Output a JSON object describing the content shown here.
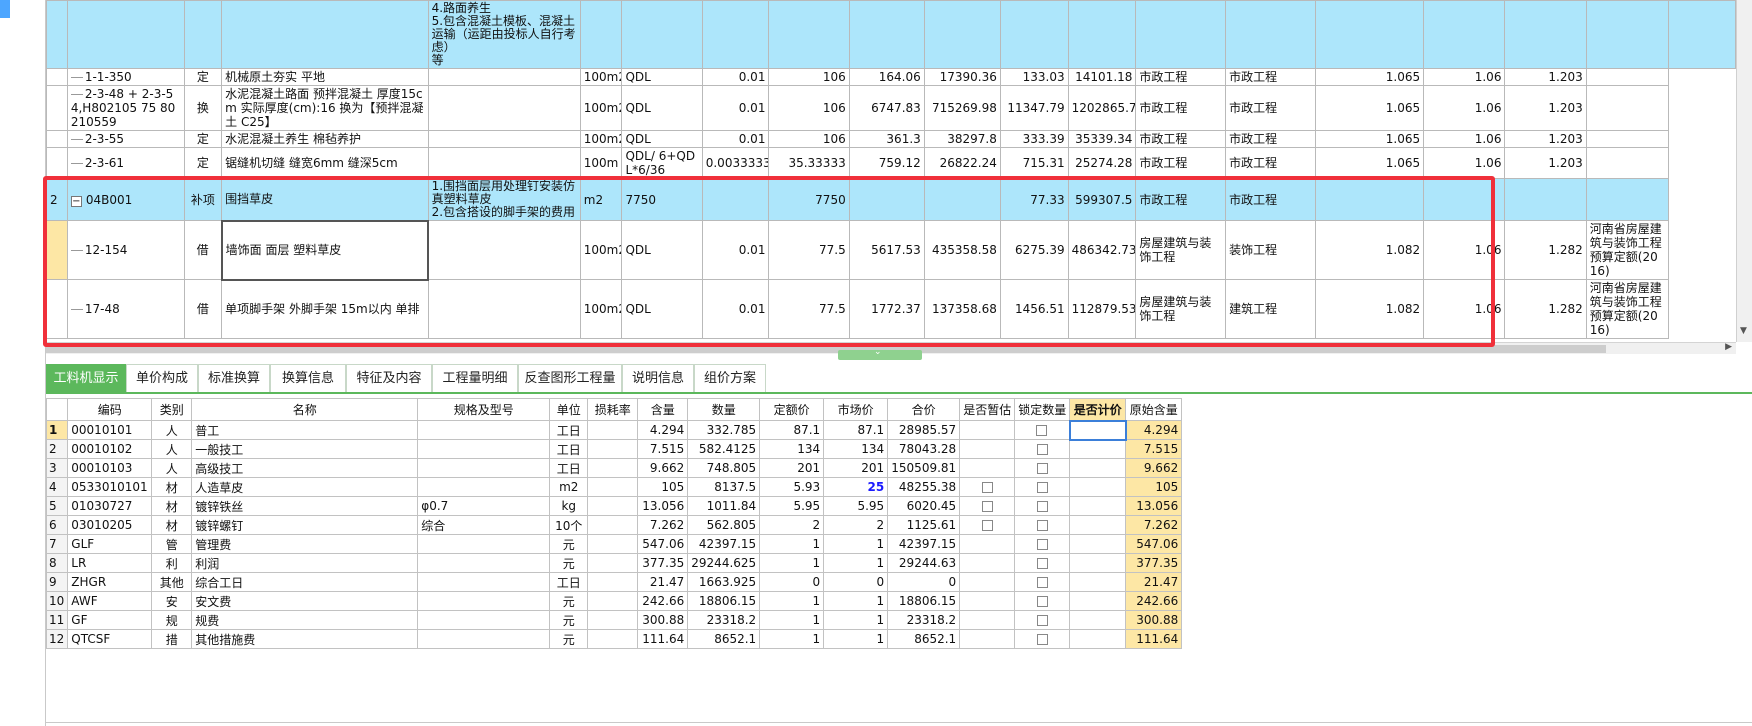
{
  "upper": {
    "top_row": {
      "description": "4.路面养生\n5.包含混凝土模板、混凝土运输（运距由投标人自行考虑）\n等"
    },
    "rows": [
      {
        "num": "",
        "code": "1-1-350",
        "type": "定",
        "name": "机械原土夯实 平地",
        "desc": "",
        "unit": "100m2",
        "qty_expr": "QDL",
        "qty": "0.01",
        "count": "106",
        "unit_price": "164.06",
        "total": "17390.36",
        "c1": "133.03",
        "c2": "14101.18",
        "major1": "市政工程",
        "major2": "市政工程",
        "f1": "1.065",
        "f2": "1.06",
        "f3": "1.203",
        "remark": ""
      },
      {
        "num": "",
        "code": "2-3-48 + 2-3-54,H802105 75 80210559",
        "type": "换",
        "name": "水泥混凝土路面 预拌混凝土 厚度15cm 实际厚度(cm):16 换为【预拌混凝土 C25】",
        "desc": "",
        "unit": "100m2",
        "qty_expr": "QDL",
        "qty": "0.01",
        "count": "106",
        "unit_price": "6747.83",
        "total": "715269.98",
        "c1": "11347.79",
        "c2": "1202865.74",
        "major1": "市政工程",
        "major2": "市政工程",
        "f1": "1.065",
        "f2": "1.06",
        "f3": "1.203",
        "remark": ""
      },
      {
        "num": "",
        "code": "2-3-55",
        "type": "定",
        "name": "水泥混凝土养生 棉毡养护",
        "desc": "",
        "unit": "100m2",
        "qty_expr": "QDL",
        "qty": "0.01",
        "count": "106",
        "unit_price": "361.3",
        "total": "38297.8",
        "c1": "333.39",
        "c2": "35339.34",
        "major1": "市政工程",
        "major2": "市政工程",
        "f1": "1.065",
        "f2": "1.06",
        "f3": "1.203",
        "remark": ""
      },
      {
        "num": "",
        "code": "2-3-61",
        "type": "定",
        "name": "锯缝机切缝 缝宽6mm 缝深5cm",
        "desc": "",
        "unit": "100m",
        "qty_expr": "QDL/ 6+QDL*6/36",
        "qty": "0.0033333",
        "count": "35.33333",
        "unit_price": "759.12",
        "total": "26822.24",
        "c1": "715.31",
        "c2": "25274.28",
        "major1": "市政工程",
        "major2": "市政工程",
        "f1": "1.065",
        "f2": "1.06",
        "f3": "1.203",
        "remark": ""
      },
      {
        "num": "2",
        "code": "04B001",
        "type": "补项",
        "name": "围挡草皮",
        "desc": "1.围挡面层用处理钉安装仿真塑料草皮\n2.包含搭设的脚手架的费用",
        "unit": "m2",
        "qty_expr": "7750",
        "qty": "",
        "count": "7750",
        "unit_price": "",
        "total": "",
        "c1": "77.33",
        "c2": "599307.5",
        "major1": "市政工程",
        "major2": "市政工程",
        "f1": "",
        "f2": "",
        "f3": "",
        "remark": ""
      },
      {
        "num": "",
        "code": "12-154",
        "type": "借",
        "name": "墙饰面 面层 塑料草皮",
        "desc": "",
        "unit": "100m2",
        "qty_expr": "QDL",
        "qty": "0.01",
        "count": "77.5",
        "unit_price": "5617.53",
        "total": "435358.58",
        "c1": "6275.39",
        "c2": "486342.73",
        "major1": "房屋建筑与装饰工程",
        "major2": "装饰工程",
        "f1": "1.082",
        "f2": "1.06",
        "f3": "1.282",
        "remark": "河南省房屋建筑与装饰工程预算定额(2016)"
      },
      {
        "num": "",
        "code": "17-48",
        "type": "借",
        "name": "单项脚手架 外脚手架 15m以内 单排",
        "desc": "",
        "unit": "100m2",
        "qty_expr": "QDL",
        "qty": "0.01",
        "count": "77.5",
        "unit_price": "1772.37",
        "total": "137358.68",
        "c1": "1456.51",
        "c2": "112879.53",
        "major1": "房屋建筑与装饰工程",
        "major2": "建筑工程",
        "f1": "1.082",
        "f2": "1.06",
        "f3": "1.282",
        "remark": "河南省房屋建筑与装饰工程预算定额(2016)"
      }
    ]
  },
  "tabs": [
    "工料机显示",
    "单价构成",
    "标准换算",
    "换算信息",
    "特征及内容",
    "工程量明细",
    "反查图形工程量",
    "说明信息",
    "组价方案"
  ],
  "lower": {
    "headers": [
      "",
      "编码",
      "类别",
      "名称",
      "规格及型号",
      "单位",
      "损耗率",
      "含量",
      "数量",
      "定额价",
      "市场价",
      "合价",
      "是否暂估",
      "锁定数量",
      "是否计价",
      "原始含量"
    ],
    "rows": [
      {
        "n": "1",
        "code": "00010101",
        "cat": "人",
        "name": "普工",
        "spec": "",
        "unit": "工日",
        "loss": "",
        "content": "4.294",
        "qty": "332.785",
        "quota": "87.1",
        "market": "87.1",
        "total": "28985.57",
        "orig": "4.294"
      },
      {
        "n": "2",
        "code": "00010102",
        "cat": "人",
        "name": "一般技工",
        "spec": "",
        "unit": "工日",
        "loss": "",
        "content": "7.515",
        "qty": "582.4125",
        "quota": "134",
        "market": "134",
        "total": "78043.28",
        "orig": "7.515"
      },
      {
        "n": "3",
        "code": "00010103",
        "cat": "人",
        "name": "高级技工",
        "spec": "",
        "unit": "工日",
        "loss": "",
        "content": "9.662",
        "qty": "748.805",
        "quota": "201",
        "market": "201",
        "total": "150509.81",
        "orig": "9.662"
      },
      {
        "n": "4",
        "code": "0533010101",
        "cat": "材",
        "name": "人造草皮",
        "spec": "",
        "unit": "m2",
        "loss": "",
        "content": "105",
        "qty": "8137.5",
        "quota": "5.93",
        "market": "25",
        "total": "48255.38",
        "orig": "105"
      },
      {
        "n": "5",
        "code": "01030727",
        "cat": "材",
        "name": "镀锌铁丝",
        "spec": "φ0.7",
        "unit": "kg",
        "loss": "",
        "content": "13.056",
        "qty": "1011.84",
        "quota": "5.95",
        "market": "5.95",
        "total": "6020.45",
        "orig": "13.056"
      },
      {
        "n": "6",
        "code": "03010205",
        "cat": "材",
        "name": "镀锌螺钉",
        "spec": "综合",
        "unit": "10个",
        "loss": "",
        "content": "7.262",
        "qty": "562.805",
        "quota": "2",
        "market": "2",
        "total": "1125.61",
        "orig": "7.262"
      },
      {
        "n": "7",
        "code": "GLF",
        "cat": "管",
        "name": "管理费",
        "spec": "",
        "unit": "元",
        "loss": "",
        "content": "547.06",
        "qty": "42397.15",
        "quota": "1",
        "market": "1",
        "total": "42397.15",
        "orig": "547.06"
      },
      {
        "n": "8",
        "code": "LR",
        "cat": "利",
        "name": "利润",
        "spec": "",
        "unit": "元",
        "loss": "",
        "content": "377.35",
        "qty": "29244.625",
        "quota": "1",
        "market": "1",
        "total": "29244.63",
        "orig": "377.35"
      },
      {
        "n": "9",
        "code": "ZHGR",
        "cat": "其他",
        "name": "综合工日",
        "spec": "",
        "unit": "工日",
        "loss": "",
        "content": "21.47",
        "qty": "1663.925",
        "quota": "0",
        "market": "0",
        "total": "0",
        "orig": "21.47"
      },
      {
        "n": "10",
        "code": "AWF",
        "cat": "安",
        "name": "安文费",
        "spec": "",
        "unit": "元",
        "loss": "",
        "content": "242.66",
        "qty": "18806.15",
        "quota": "1",
        "market": "1",
        "total": "18806.15",
        "orig": "242.66"
      },
      {
        "n": "11",
        "code": "GF",
        "cat": "规",
        "name": "规费",
        "spec": "",
        "unit": "元",
        "loss": "",
        "content": "300.88",
        "qty": "23318.2",
        "quota": "1",
        "market": "1",
        "total": "23318.2",
        "orig": "300.88"
      },
      {
        "n": "12",
        "code": "QTCSF",
        "cat": "措",
        "name": "其他措施费",
        "spec": "",
        "unit": "元",
        "loss": "",
        "content": "111.64",
        "qty": "8652.1",
        "quota": "1",
        "market": "1",
        "total": "8652.1",
        "orig": "111.64"
      }
    ]
  },
  "colors": {
    "row_blue": "#ade6fb",
    "accent_green": "#5cb85c",
    "highlight_red": "#f0303a",
    "header_yellow": "#fde7a5"
  }
}
